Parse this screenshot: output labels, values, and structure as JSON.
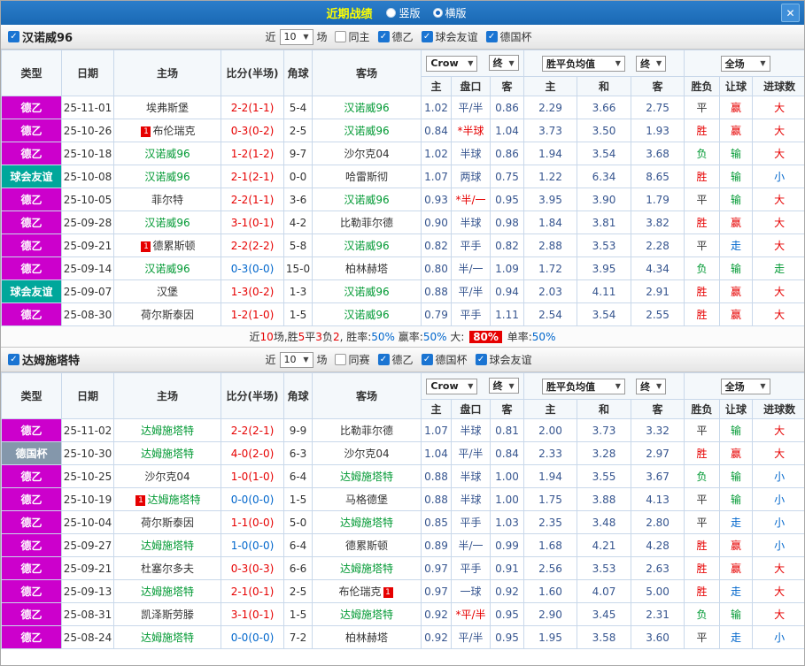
{
  "topbar": {
    "title": "近期战绩",
    "radio_vertical": "竖版",
    "radio_horizontal": "横版",
    "close_icon": "✕"
  },
  "palette": {
    "red": "#e60000",
    "blue": "#0066cc",
    "green": "#009933",
    "black": "#333333",
    "magenta": "#cc00cc",
    "teal": "#00a79b",
    "cupgray": "#8497ab",
    "odds": "#36558f"
  },
  "header": {
    "type": "类型",
    "date": "日期",
    "home": "主场",
    "score": "比分(半场)",
    "corner": "角球",
    "away": "客场",
    "odds_home": "主",
    "odds_pan": "盘口",
    "odds_away": "客",
    "avg_home": "主",
    "avg_draw": "和",
    "avg_away": "客",
    "wdl": "胜负",
    "rang": "让球",
    "goals": "进球数",
    "dd_crow": "Crow",
    "dd_final": "终",
    "dd_avg": "胜平负均值",
    "dd_fullmatch": "全场"
  },
  "sections": [
    {
      "team": "汉诺威96",
      "checked": true,
      "filter": {
        "near": "近",
        "count": "10",
        "games": "场",
        "checkboxes": [
          {
            "label": "同主",
            "checked": false
          },
          {
            "label": "德乙",
            "checked": true
          },
          {
            "label": "球会友谊",
            "checked": true
          },
          {
            "label": "德国杯",
            "checked": true
          }
        ]
      },
      "rows": [
        {
          "lg": "德乙",
          "lgK": "magenta",
          "date": "25-11-01",
          "home": "埃弗斯堡",
          "hT": false,
          "hCard": null,
          "score": "2-2(1-1)",
          "scoreK": "red",
          "corner": "5-4",
          "away": "汉诺威96",
          "aT": true,
          "aCard": null,
          "oH": "1.02",
          "pan": "平/半",
          "panK": null,
          "oA": "0.86",
          "aH": "2.29",
          "aD": "3.66",
          "aA": "2.75",
          "wdl": "平",
          "wdlK": "black",
          "rang": "赢",
          "rangK": "red",
          "jin": "大",
          "jinK": "red"
        },
        {
          "lg": "德乙",
          "lgK": "magenta",
          "date": "25-10-26",
          "home": "布伦瑞克",
          "hT": false,
          "hCard": "1",
          "score": "0-3(0-2)",
          "scoreK": "red",
          "corner": "2-5",
          "away": "汉诺威96",
          "aT": true,
          "aCard": null,
          "oH": "0.84",
          "pan": "*半球",
          "panK": "red",
          "oA": "1.04",
          "aH": "3.73",
          "aD": "3.50",
          "aA": "1.93",
          "wdl": "胜",
          "wdlK": "red",
          "rang": "赢",
          "rangK": "red",
          "jin": "大",
          "jinK": "red"
        },
        {
          "lg": "德乙",
          "lgK": "magenta",
          "date": "25-10-18",
          "home": "汉诺威96",
          "hT": true,
          "hCard": null,
          "score": "1-2(1-2)",
          "scoreK": "red",
          "corner": "9-7",
          "away": "沙尔克04",
          "aT": false,
          "aCard": null,
          "oH": "1.02",
          "pan": "半球",
          "panK": null,
          "oA": "0.86",
          "aH": "1.94",
          "aD": "3.54",
          "aA": "3.68",
          "wdl": "负",
          "wdlK": "green",
          "rang": "输",
          "rangK": "green",
          "jin": "大",
          "jinK": "red"
        },
        {
          "lg": "球会友谊",
          "lgK": "teal",
          "date": "25-10-08",
          "home": "汉诺威96",
          "hT": true,
          "hCard": null,
          "score": "2-1(2-1)",
          "scoreK": "red",
          "corner": "0-0",
          "away": "哈雷斯彻",
          "aT": false,
          "aCard": null,
          "oH": "1.07",
          "pan": "两球",
          "panK": null,
          "oA": "0.75",
          "aH": "1.22",
          "aD": "6.34",
          "aA": "8.65",
          "wdl": "胜",
          "wdlK": "red",
          "rang": "输",
          "rangK": "green",
          "jin": "小",
          "jinK": "blue"
        },
        {
          "lg": "德乙",
          "lgK": "magenta",
          "date": "25-10-05",
          "home": "菲尔特",
          "hT": false,
          "hCard": null,
          "score": "2-2(1-1)",
          "scoreK": "red",
          "corner": "3-6",
          "away": "汉诺威96",
          "aT": true,
          "aCard": null,
          "oH": "0.93",
          "pan": "*半/一",
          "panK": "red",
          "oA": "0.95",
          "aH": "3.95",
          "aD": "3.90",
          "aA": "1.79",
          "wdl": "平",
          "wdlK": "black",
          "rang": "输",
          "rangK": "green",
          "jin": "大",
          "jinK": "red"
        },
        {
          "lg": "德乙",
          "lgK": "magenta",
          "date": "25-09-28",
          "home": "汉诺威96",
          "hT": true,
          "hCard": null,
          "score": "3-1(0-1)",
          "scoreK": "red",
          "corner": "4-2",
          "away": "比勒菲尔德",
          "aT": false,
          "aCard": null,
          "oH": "0.90",
          "pan": "半球",
          "panK": null,
          "oA": "0.98",
          "aH": "1.84",
          "aD": "3.81",
          "aA": "3.82",
          "wdl": "胜",
          "wdlK": "red",
          "rang": "赢",
          "rangK": "red",
          "jin": "大",
          "jinK": "red"
        },
        {
          "lg": "德乙",
          "lgK": "magenta",
          "date": "25-09-21",
          "home": "德累斯顿",
          "hT": false,
          "hCard": "1",
          "score": "2-2(2-2)",
          "scoreK": "red",
          "corner": "5-8",
          "away": "汉诺威96",
          "aT": true,
          "aCard": null,
          "oH": "0.82",
          "pan": "平手",
          "panK": null,
          "oA": "0.82",
          "aH": "2.88",
          "aD": "3.53",
          "aA": "2.28",
          "wdl": "平",
          "wdlK": "black",
          "rang": "走",
          "rangK": "blue",
          "jin": "大",
          "jinK": "red"
        },
        {
          "lg": "德乙",
          "lgK": "magenta",
          "date": "25-09-14",
          "home": "汉诺威96",
          "hT": true,
          "hCard": null,
          "score": "0-3(0-0)",
          "scoreK": "blue",
          "corner": "15-0",
          "away": "柏林赫塔",
          "aT": false,
          "aCard": null,
          "oH": "0.80",
          "pan": "半/一",
          "panK": null,
          "oA": "1.09",
          "aH": "1.72",
          "aD": "3.95",
          "aA": "4.34",
          "wdl": "负",
          "wdlK": "green",
          "rang": "输",
          "rangK": "green",
          "jin": "走",
          "jinK": "green"
        },
        {
          "lg": "球会友谊",
          "lgK": "teal",
          "date": "25-09-07",
          "home": "汉堡",
          "hT": false,
          "hCard": null,
          "score": "1-3(0-2)",
          "scoreK": "red",
          "corner": "1-3",
          "away": "汉诺威96",
          "aT": true,
          "aCard": null,
          "oH": "0.88",
          "pan": "平/半",
          "panK": null,
          "oA": "0.94",
          "aH": "2.03",
          "aD": "4.11",
          "aA": "2.91",
          "wdl": "胜",
          "wdlK": "red",
          "rang": "赢",
          "rangK": "red",
          "jin": "大",
          "jinK": "red"
        },
        {
          "lg": "德乙",
          "lgK": "magenta",
          "date": "25-08-30",
          "home": "荷尔斯泰因",
          "hT": false,
          "hCard": null,
          "score": "1-2(1-0)",
          "scoreK": "red",
          "corner": "1-5",
          "away": "汉诺威96",
          "aT": true,
          "aCard": null,
          "oH": "0.79",
          "pan": "平手",
          "panK": null,
          "oA": "1.11",
          "aH": "2.54",
          "aD": "3.54",
          "aA": "2.55",
          "wdl": "胜",
          "wdlK": "red",
          "rang": "赢",
          "rangK": "red",
          "jin": "大",
          "jinK": "red"
        }
      ],
      "summary": {
        "parts": [
          {
            "t": "近",
            "c": "black"
          },
          {
            "t": "10",
            "c": "red"
          },
          {
            "t": "场,胜",
            "c": "black"
          },
          {
            "t": "5",
            "c": "red"
          },
          {
            "t": "平",
            "c": "black"
          },
          {
            "t": "3",
            "c": "red"
          },
          {
            "t": "负",
            "c": "black"
          },
          {
            "t": "2",
            "c": "red"
          },
          {
            "t": ", 胜率:",
            "c": "black"
          },
          {
            "t": "50%",
            "c": "blue"
          },
          {
            "t": " 赢率:",
            "c": "black"
          },
          {
            "t": "50%",
            "c": "blue"
          },
          {
            "t": " 大: ",
            "c": "black"
          },
          {
            "t": "80%",
            "c": "badge"
          },
          {
            "t": " 单率:",
            "c": "black"
          },
          {
            "t": "50%",
            "c": "blue"
          }
        ]
      }
    },
    {
      "team": "达姆施塔特",
      "checked": true,
      "filter": {
        "near": "近",
        "count": "10",
        "games": "场",
        "checkboxes": [
          {
            "label": "同赛",
            "checked": false
          },
          {
            "label": "德乙",
            "checked": true
          },
          {
            "label": "德国杯",
            "checked": true
          },
          {
            "label": "球会友谊",
            "checked": true
          }
        ]
      },
      "rows": [
        {
          "lg": "德乙",
          "lgK": "magenta",
          "date": "25-11-02",
          "home": "达姆施塔特",
          "hT": true,
          "hCard": null,
          "score": "2-2(2-1)",
          "scoreK": "red",
          "corner": "9-9",
          "away": "比勒菲尔德",
          "aT": false,
          "aCard": null,
          "oH": "1.07",
          "pan": "半球",
          "panK": null,
          "oA": "0.81",
          "aH": "2.00",
          "aD": "3.73",
          "aA": "3.32",
          "wdl": "平",
          "wdlK": "black",
          "rang": "输",
          "rangK": "green",
          "jin": "大",
          "jinK": "red"
        },
        {
          "lg": "德国杯",
          "lgK": "cupgray",
          "date": "25-10-30",
          "home": "达姆施塔特",
          "hT": true,
          "hCard": null,
          "score": "4-0(2-0)",
          "scoreK": "red",
          "corner": "6-3",
          "away": "沙尔克04",
          "aT": false,
          "aCard": null,
          "oH": "1.04",
          "pan": "平/半",
          "panK": null,
          "oA": "0.84",
          "aH": "2.33",
          "aD": "3.28",
          "aA": "2.97",
          "wdl": "胜",
          "wdlK": "red",
          "rang": "赢",
          "rangK": "red",
          "jin": "大",
          "jinK": "red"
        },
        {
          "lg": "德乙",
          "lgK": "magenta",
          "date": "25-10-25",
          "home": "沙尔克04",
          "hT": false,
          "hCard": null,
          "score": "1-0(1-0)",
          "scoreK": "red",
          "corner": "6-4",
          "away": "达姆施塔特",
          "aT": true,
          "aCard": null,
          "oH": "0.88",
          "pan": "半球",
          "panK": null,
          "oA": "1.00",
          "aH": "1.94",
          "aD": "3.55",
          "aA": "3.67",
          "wdl": "负",
          "wdlK": "green",
          "rang": "输",
          "rangK": "green",
          "jin": "小",
          "jinK": "blue"
        },
        {
          "lg": "德乙",
          "lgK": "magenta",
          "date": "25-10-19",
          "home": "达姆施塔特",
          "hT": true,
          "hCard": "1",
          "score": "0-0(0-0)",
          "scoreK": "blue",
          "corner": "1-5",
          "away": "马格德堡",
          "aT": false,
          "aCard": null,
          "oH": "0.88",
          "pan": "半球",
          "panK": null,
          "oA": "1.00",
          "aH": "1.75",
          "aD": "3.88",
          "aA": "4.13",
          "wdl": "平",
          "wdlK": "black",
          "rang": "输",
          "rangK": "green",
          "jin": "小",
          "jinK": "blue"
        },
        {
          "lg": "德乙",
          "lgK": "magenta",
          "date": "25-10-04",
          "home": "荷尔斯泰因",
          "hT": false,
          "hCard": null,
          "score": "1-1(0-0)",
          "scoreK": "red",
          "corner": "5-0",
          "away": "达姆施塔特",
          "aT": true,
          "aCard": null,
          "oH": "0.85",
          "pan": "平手",
          "panK": null,
          "oA": "1.03",
          "aH": "2.35",
          "aD": "3.48",
          "aA": "2.80",
          "wdl": "平",
          "wdlK": "black",
          "rang": "走",
          "rangK": "blue",
          "jin": "小",
          "jinK": "blue"
        },
        {
          "lg": "德乙",
          "lgK": "magenta",
          "date": "25-09-27",
          "home": "达姆施塔特",
          "hT": true,
          "hCard": null,
          "score": "1-0(0-0)",
          "scoreK": "blue",
          "corner": "6-4",
          "away": "德累斯顿",
          "aT": false,
          "aCard": null,
          "oH": "0.89",
          "pan": "半/一",
          "panK": null,
          "oA": "0.99",
          "aH": "1.68",
          "aD": "4.21",
          "aA": "4.28",
          "wdl": "胜",
          "wdlK": "red",
          "rang": "赢",
          "rangK": "red",
          "jin": "小",
          "jinK": "blue"
        },
        {
          "lg": "德乙",
          "lgK": "magenta",
          "date": "25-09-21",
          "home": "杜塞尔多夫",
          "hT": false,
          "hCard": null,
          "score": "0-3(0-3)",
          "scoreK": "red",
          "corner": "6-6",
          "away": "达姆施塔特",
          "aT": true,
          "aCard": null,
          "oH": "0.97",
          "pan": "平手",
          "panK": null,
          "oA": "0.91",
          "aH": "2.56",
          "aD": "3.53",
          "aA": "2.63",
          "wdl": "胜",
          "wdlK": "red",
          "rang": "赢",
          "rangK": "red",
          "jin": "大",
          "jinK": "red"
        },
        {
          "lg": "德乙",
          "lgK": "magenta",
          "date": "25-09-13",
          "home": "达姆施塔特",
          "hT": true,
          "hCard": null,
          "score": "2-1(0-1)",
          "scoreK": "red",
          "corner": "2-5",
          "away": "布伦瑞克",
          "aT": false,
          "aCard": "1",
          "oH": "0.97",
          "pan": "一球",
          "panK": null,
          "oA": "0.92",
          "aH": "1.60",
          "aD": "4.07",
          "aA": "5.00",
          "wdl": "胜",
          "wdlK": "red",
          "rang": "走",
          "rangK": "blue",
          "jin": "大",
          "jinK": "red"
        },
        {
          "lg": "德乙",
          "lgK": "magenta",
          "date": "25-08-31",
          "home": "凯泽斯劳滕",
          "hT": false,
          "hCard": null,
          "score": "3-1(0-1)",
          "scoreK": "red",
          "corner": "1-5",
          "away": "达姆施塔特",
          "aT": true,
          "aCard": null,
          "oH": "0.92",
          "pan": "*平/半",
          "panK": "red",
          "oA": "0.95",
          "aH": "2.90",
          "aD": "3.45",
          "aA": "2.31",
          "wdl": "负",
          "wdlK": "green",
          "rang": "输",
          "rangK": "green",
          "jin": "大",
          "jinK": "red"
        },
        {
          "lg": "德乙",
          "lgK": "magenta",
          "date": "25-08-24",
          "home": "达姆施塔特",
          "hT": true,
          "hCard": null,
          "score": "0-0(0-0)",
          "scoreK": "blue",
          "corner": "7-2",
          "away": "柏林赫塔",
          "aT": false,
          "aCard": null,
          "oH": "0.92",
          "pan": "平/半",
          "panK": null,
          "oA": "0.95",
          "aH": "1.95",
          "aD": "3.58",
          "aA": "3.60",
          "wdl": "平",
          "wdlK": "black",
          "rang": "走",
          "rangK": "blue",
          "jin": "小",
          "jinK": "blue"
        }
      ],
      "summary": null
    }
  ]
}
